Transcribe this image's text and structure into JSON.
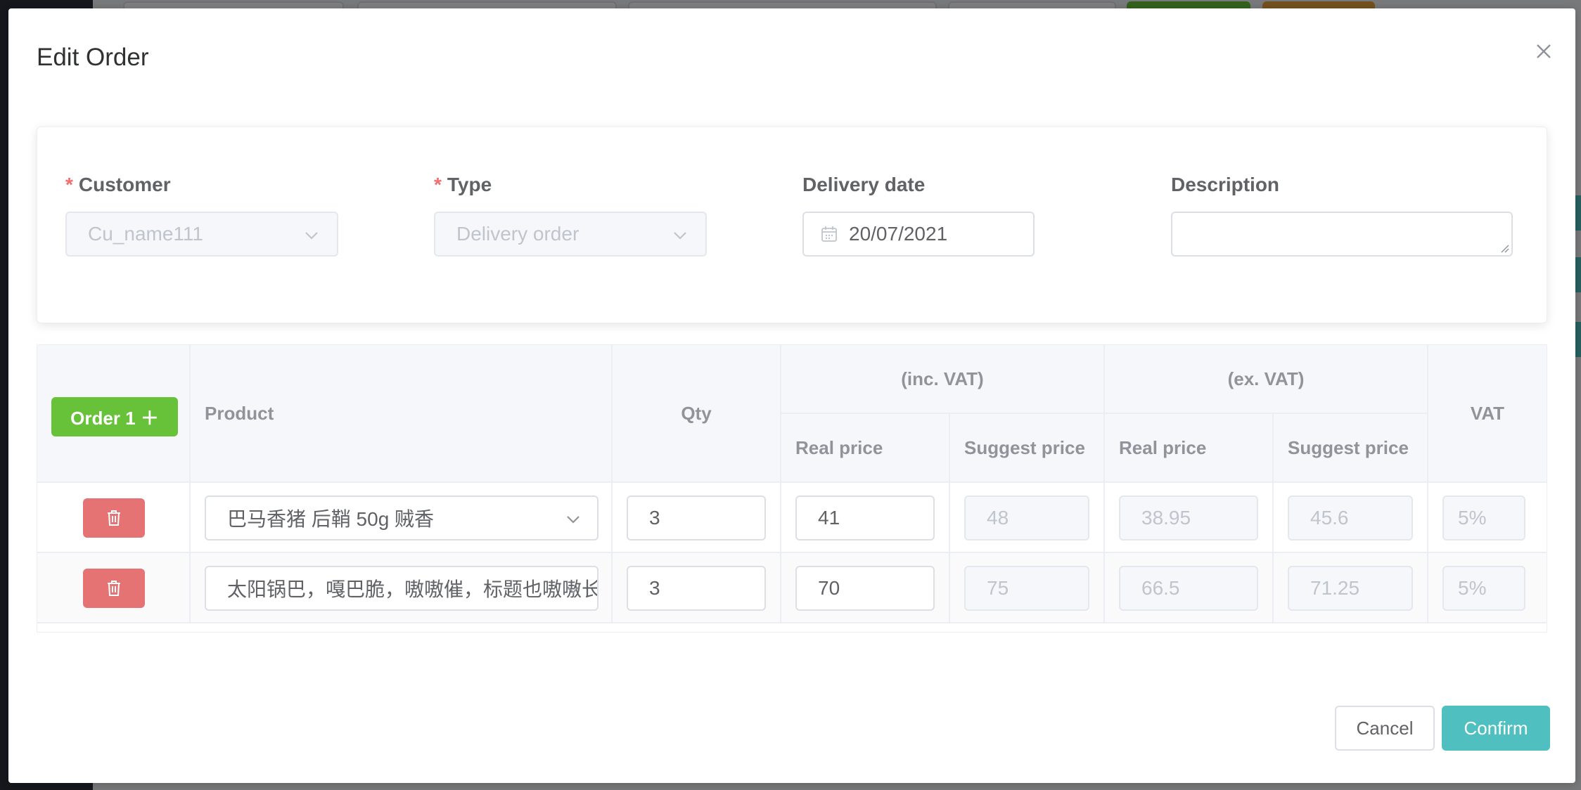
{
  "modal": {
    "title": "Edit Order",
    "close_icon": "close-icon"
  },
  "form": {
    "customer": {
      "label": "Customer",
      "value": "Cu_name111"
    },
    "type": {
      "label": "Type",
      "value": "Delivery order"
    },
    "delivery_date": {
      "label": "Delivery date",
      "value": "20/07/2021"
    },
    "description": {
      "label": "Description",
      "value": ""
    },
    "required_mark": "*"
  },
  "table": {
    "order_button": "Order 1 ＋",
    "headers": {
      "product": "Product",
      "qty": "Qty",
      "inc_vat": "(inc. VAT)",
      "ex_vat": "(ex. VAT)",
      "real_price": "Real price",
      "suggest_price": "Suggest price",
      "vat": "VAT"
    },
    "rows": [
      {
        "product": "巴马香猪 后鞘 50g 贼香",
        "qty": "3",
        "inc_real": "41",
        "inc_suggest": "48",
        "ex_real": "38.95",
        "ex_suggest": "45.6",
        "vat": "5%"
      },
      {
        "product": "太阳锅巴，嘎巴脆，嗷嗷催，标题也嗷嗷长",
        "qty": "3",
        "inc_real": "70",
        "inc_suggest": "75",
        "ex_real": "66.5",
        "ex_suggest": "71.25",
        "vat": "5%"
      }
    ]
  },
  "footer": {
    "cancel": "Cancel",
    "confirm": "Confirm"
  },
  "colors": {
    "primary": "#4fbfbf",
    "success": "#67c23a",
    "danger": "#e57373",
    "required": "#f56c6c"
  }
}
